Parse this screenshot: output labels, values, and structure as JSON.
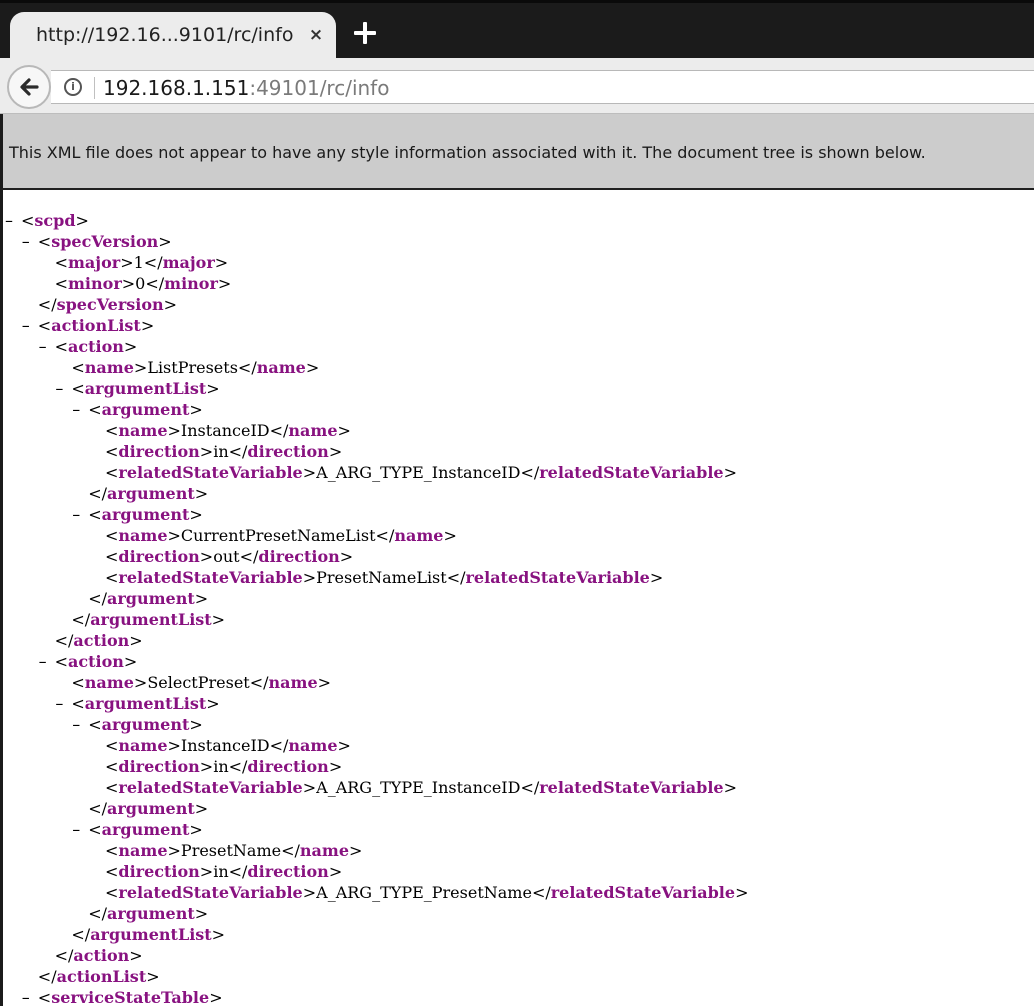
{
  "browser": {
    "tab_title": "http://192.16...9101/rc/info",
    "tab_close": "×",
    "url_host": "192.168.1.151",
    "url_path": ":49101/rc/info",
    "info_icon_glyph": "i"
  },
  "banner": {
    "text": "This XML file does not appear to have any style information associated with it. The document tree is shown below."
  },
  "collapse_glyph": "–",
  "xml_lines": [
    {
      "depth": 0,
      "collapsible": true,
      "kind": "open",
      "tag": "scpd"
    },
    {
      "depth": 1,
      "collapsible": true,
      "kind": "open",
      "tag": "specVersion"
    },
    {
      "depth": 2,
      "collapsible": false,
      "kind": "leaf",
      "tag": "major",
      "text": "1"
    },
    {
      "depth": 2,
      "collapsible": false,
      "kind": "leaf",
      "tag": "minor",
      "text": "0"
    },
    {
      "depth": 1,
      "collapsible": false,
      "kind": "close",
      "tag": "specVersion"
    },
    {
      "depth": 1,
      "collapsible": true,
      "kind": "open",
      "tag": "actionList"
    },
    {
      "depth": 2,
      "collapsible": true,
      "kind": "open",
      "tag": "action"
    },
    {
      "depth": 3,
      "collapsible": false,
      "kind": "leaf",
      "tag": "name",
      "text": "ListPresets"
    },
    {
      "depth": 3,
      "collapsible": true,
      "kind": "open",
      "tag": "argumentList"
    },
    {
      "depth": 4,
      "collapsible": true,
      "kind": "open",
      "tag": "argument"
    },
    {
      "depth": 5,
      "collapsible": false,
      "kind": "leaf",
      "tag": "name",
      "text": "InstanceID"
    },
    {
      "depth": 5,
      "collapsible": false,
      "kind": "leaf",
      "tag": "direction",
      "text": "in"
    },
    {
      "depth": 5,
      "collapsible": false,
      "kind": "leaf",
      "tag": "relatedStateVariable",
      "text": "A_ARG_TYPE_InstanceID"
    },
    {
      "depth": 4,
      "collapsible": false,
      "kind": "close",
      "tag": "argument"
    },
    {
      "depth": 4,
      "collapsible": true,
      "kind": "open",
      "tag": "argument"
    },
    {
      "depth": 5,
      "collapsible": false,
      "kind": "leaf",
      "tag": "name",
      "text": "CurrentPresetNameList"
    },
    {
      "depth": 5,
      "collapsible": false,
      "kind": "leaf",
      "tag": "direction",
      "text": "out"
    },
    {
      "depth": 5,
      "collapsible": false,
      "kind": "leaf",
      "tag": "relatedStateVariable",
      "text": "PresetNameList"
    },
    {
      "depth": 4,
      "collapsible": false,
      "kind": "close",
      "tag": "argument"
    },
    {
      "depth": 3,
      "collapsible": false,
      "kind": "close",
      "tag": "argumentList"
    },
    {
      "depth": 2,
      "collapsible": false,
      "kind": "close",
      "tag": "action"
    },
    {
      "depth": 2,
      "collapsible": true,
      "kind": "open",
      "tag": "action"
    },
    {
      "depth": 3,
      "collapsible": false,
      "kind": "leaf",
      "tag": "name",
      "text": "SelectPreset"
    },
    {
      "depth": 3,
      "collapsible": true,
      "kind": "open",
      "tag": "argumentList"
    },
    {
      "depth": 4,
      "collapsible": true,
      "kind": "open",
      "tag": "argument"
    },
    {
      "depth": 5,
      "collapsible": false,
      "kind": "leaf",
      "tag": "name",
      "text": "InstanceID"
    },
    {
      "depth": 5,
      "collapsible": false,
      "kind": "leaf",
      "tag": "direction",
      "text": "in"
    },
    {
      "depth": 5,
      "collapsible": false,
      "kind": "leaf",
      "tag": "relatedStateVariable",
      "text": "A_ARG_TYPE_InstanceID"
    },
    {
      "depth": 4,
      "collapsible": false,
      "kind": "close",
      "tag": "argument"
    },
    {
      "depth": 4,
      "collapsible": true,
      "kind": "open",
      "tag": "argument"
    },
    {
      "depth": 5,
      "collapsible": false,
      "kind": "leaf",
      "tag": "name",
      "text": "PresetName"
    },
    {
      "depth": 5,
      "collapsible": false,
      "kind": "leaf",
      "tag": "direction",
      "text": "in"
    },
    {
      "depth": 5,
      "collapsible": false,
      "kind": "leaf",
      "tag": "relatedStateVariable",
      "text": "A_ARG_TYPE_PresetName"
    },
    {
      "depth": 4,
      "collapsible": false,
      "kind": "close",
      "tag": "argument"
    },
    {
      "depth": 3,
      "collapsible": false,
      "kind": "close",
      "tag": "argumentList"
    },
    {
      "depth": 2,
      "collapsible": false,
      "kind": "close",
      "tag": "action"
    },
    {
      "depth": 1,
      "collapsible": false,
      "kind": "close",
      "tag": "actionList"
    },
    {
      "depth": 1,
      "collapsible": true,
      "kind": "open",
      "tag": "serviceStateTable"
    }
  ],
  "colors": {
    "tag": "#881280",
    "chrome_dark": "#1b1b1b",
    "banner_bg": "#cccccc"
  }
}
